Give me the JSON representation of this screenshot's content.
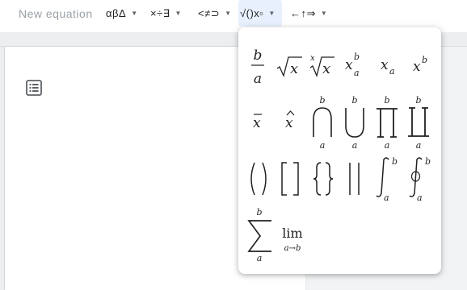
{
  "toolbar": {
    "new_equation_label": "New equation",
    "menus": [
      {
        "label": "αβΔ"
      },
      {
        "label": "×÷∃"
      },
      {
        "label": "<≠⊃"
      },
      {
        "label": "√()x▫"
      },
      {
        "label": "←↑⇒"
      }
    ]
  },
  "palette": {
    "sub": "a",
    "sup": "b",
    "base": "x",
    "lim_label": "lim",
    "lim_sub": "a→b",
    "symbols": [
      "fraction",
      "square-root",
      "nth-root",
      "sub-superscript",
      "subscript",
      "superscript",
      "bar",
      "hat",
      "big-intersection",
      "big-union",
      "big-product",
      "big-coproduct",
      "parentheses",
      "brackets",
      "braces",
      "absolute-value",
      "integral",
      "contour-integral",
      "summation",
      "limit"
    ]
  },
  "colors": {
    "toolbar_bg": "#ffffff",
    "active_menu_bg": "#e8f0fe",
    "canvas_bg": "#f1f3f4",
    "text": "#202124",
    "placeholder": "#9aa0a6"
  }
}
